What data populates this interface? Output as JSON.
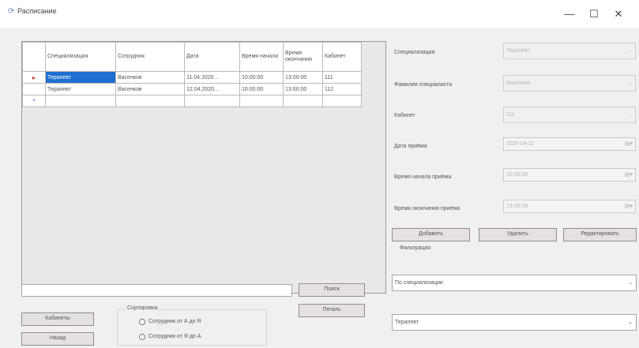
{
  "window": {
    "title": "Расписание",
    "icon": "app-icon",
    "controls": {
      "minimize": "—",
      "maximize": "☐",
      "close": "✕"
    }
  },
  "grid": {
    "columns": [
      "Специализация",
      "Сотрудник",
      "Дата",
      "Время начала",
      "Время окончания",
      "Кабинет"
    ],
    "rows": [
      {
        "marker": "▸",
        "cells": [
          "Терапевт",
          "Васенков",
          "11.04.2020...",
          "10:00:00",
          "13:00:00",
          "111"
        ]
      },
      {
        "marker": "",
        "cells": [
          "Терапевт",
          "Васенков",
          "12.04.2020...",
          "10:00:00",
          "13:00:00",
          "112"
        ]
      },
      {
        "marker": "*",
        "cells": [
          "",
          "",
          "",
          "",
          "",
          ""
        ]
      }
    ]
  },
  "search": {
    "value": "",
    "button_label": "Поиск"
  },
  "print_button_label": "Печать",
  "cabinets_button_label": "Кабинеты",
  "back_button_label": "Назад",
  "sort": {
    "title": "Сортировка",
    "options": [
      "Сотрудник от А до Я",
      "Сотрудник от Я до А"
    ]
  },
  "form": {
    "specialization": {
      "label": "Специализация",
      "value": "Терапевт"
    },
    "surname": {
      "label": "Фамилия специалиста",
      "value": "Васенков"
    },
    "cabinet": {
      "label": "Кабинет",
      "value": "111"
    },
    "date": {
      "label": "Дата приёма",
      "value": "2020-04-11"
    },
    "start": {
      "label": "Время начала приёма",
      "value": "10:00:00"
    },
    "end": {
      "label": "Время окончания приёма",
      "value": "13:00:00"
    }
  },
  "actions": {
    "add": "Добавить",
    "delete": "Удалить",
    "edit": "Редактировать"
  },
  "filter": {
    "title": "Фильтрация",
    "by": "По специализации",
    "value": "Терапевт"
  }
}
